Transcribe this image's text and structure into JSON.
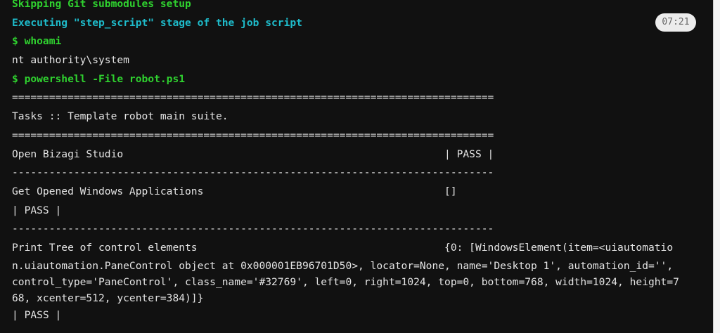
{
  "timestamp": "07:21",
  "lines": [
    {
      "text": "Skipping Git submodules setup",
      "style": "green"
    },
    {
      "text": "Executing \"step_script\" stage of the job script",
      "style": "cyan"
    },
    {
      "text": "$ whoami",
      "style": "green"
    },
    {
      "text": "nt authority\\system",
      "style": "plain"
    },
    {
      "text": "$ powershell -File robot.ps1",
      "style": "green"
    },
    {
      "text": "==============================================================================",
      "style": "plain"
    },
    {
      "text": "Tasks :: Template robot main suite.",
      "style": "plain"
    },
    {
      "text": "==============================================================================",
      "style": "plain"
    },
    {
      "text": "Open Bizagi Studio                                                    | PASS |",
      "style": "plain"
    },
    {
      "text": "------------------------------------------------------------------------------",
      "style": "plain"
    },
    {
      "text": "Get Opened Windows Applications                                       []",
      "style": "plain"
    },
    {
      "text": "| PASS |",
      "style": "plain"
    },
    {
      "text": "------------------------------------------------------------------------------",
      "style": "plain"
    },
    {
      "text": "Print Tree of control elements                                        {0: [WindowsElement(item=<uiautomatio",
      "style": "plain"
    },
    {
      "text": "n.uiautomation.PaneControl object at 0x000001EB96701D50>, locator=None, name='Desktop 1', automation_id='',",
      "style": "wrap"
    },
    {
      "text": "control_type='PaneControl', class_name='#32769', left=0, right=1024, top=0, bottom=768, width=1024, height=7",
      "style": "wrap"
    },
    {
      "text": "68, xcenter=512, ycenter=384)]}",
      "style": "wrap"
    },
    {
      "text": "| PASS |",
      "style": "plain"
    }
  ]
}
